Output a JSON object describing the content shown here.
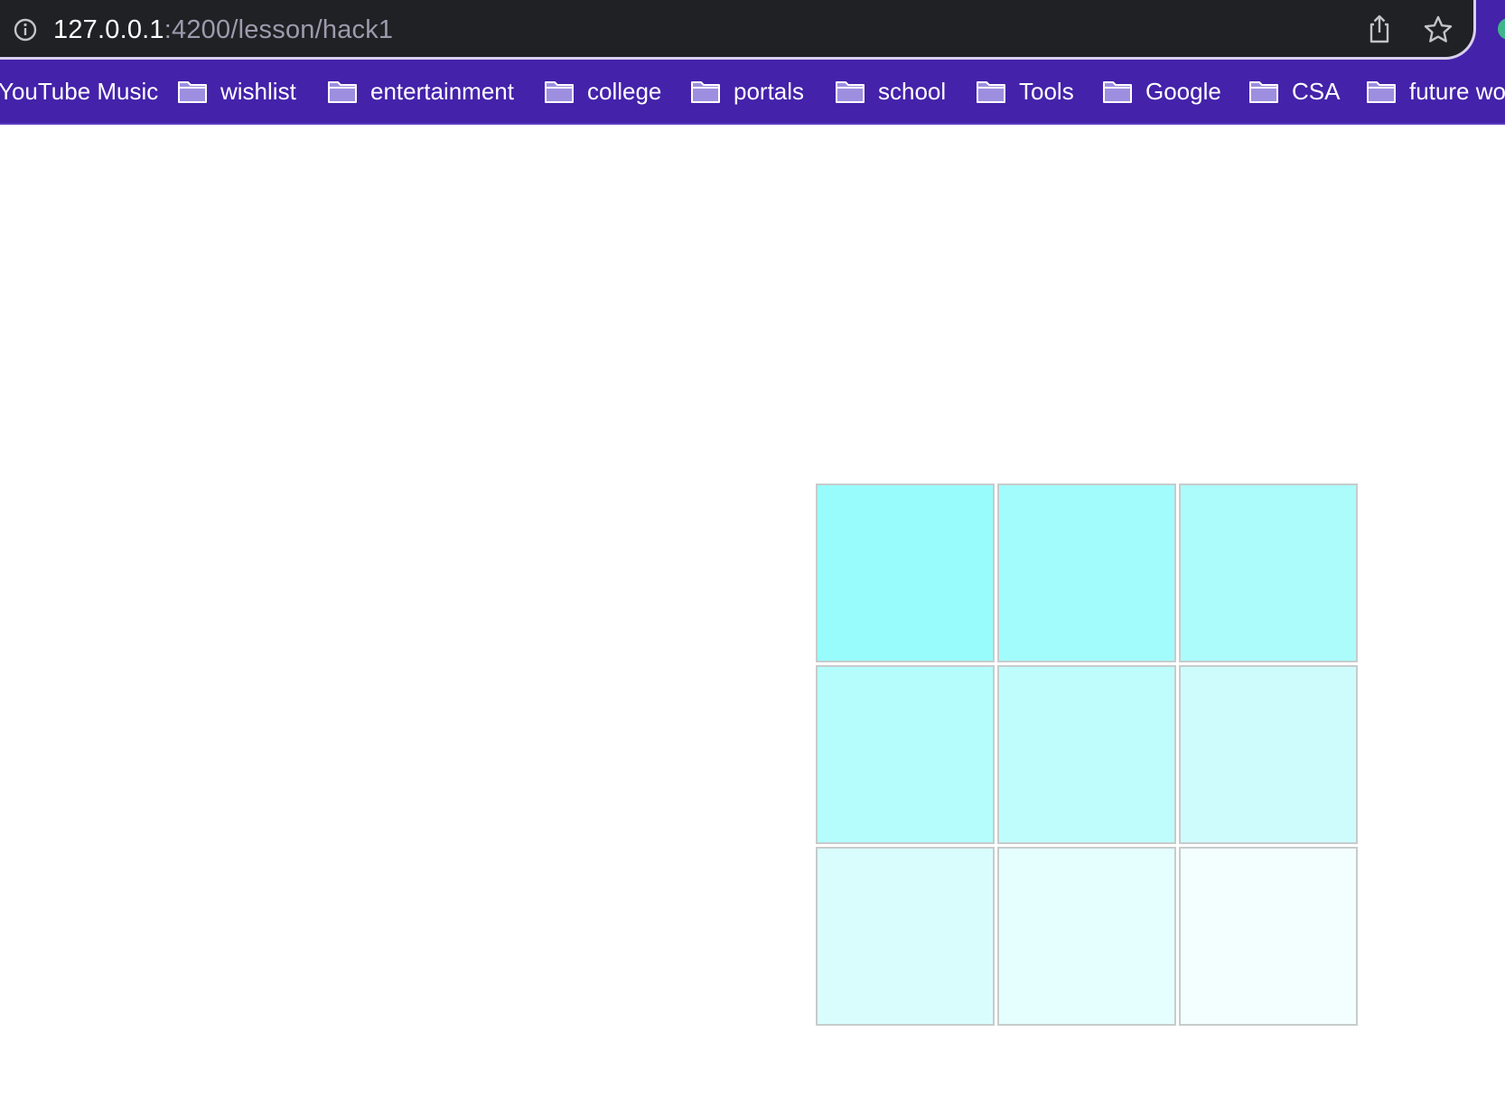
{
  "browser": {
    "url_host": "127.0.0.1",
    "url_path": ":4200/lesson/hack1",
    "icons": {
      "site_info": "info-icon",
      "share": "share-icon",
      "bookmark_star": "star-icon",
      "profile": "profile-icon"
    }
  },
  "bookmarks": {
    "items": [
      {
        "label": "YouTube Music",
        "icon": "none"
      },
      {
        "label": "wishlist",
        "icon": "folder-icon"
      },
      {
        "label": "entertainment",
        "icon": "folder-icon"
      },
      {
        "label": "college",
        "icon": "folder-icon"
      },
      {
        "label": "portals",
        "icon": "folder-icon"
      },
      {
        "label": "school",
        "icon": "folder-icon"
      },
      {
        "label": "Tools",
        "icon": "folder-icon"
      },
      {
        "label": "Google",
        "icon": "folder-icon"
      },
      {
        "label": "CSA",
        "icon": "folder-icon"
      },
      {
        "label": "future wo",
        "icon": "folder-icon"
      }
    ]
  },
  "colors": {
    "bookmark_bar_bg": "#4422aa",
    "omnibox_bg": "#202124",
    "cell_border": "#c6cccc"
  },
  "grid": {
    "rows": 3,
    "cols": 3,
    "cells": [
      {
        "color": "#99fcfc"
      },
      {
        "color": "#a3fcfc"
      },
      {
        "color": "#acfcfc"
      },
      {
        "color": "#b5fdfd"
      },
      {
        "color": "#bffdfd"
      },
      {
        "color": "#cefcfc"
      },
      {
        "color": "#d9fdfd"
      },
      {
        "color": "#e5fefe"
      },
      {
        "color": "#f3fefe"
      }
    ]
  }
}
